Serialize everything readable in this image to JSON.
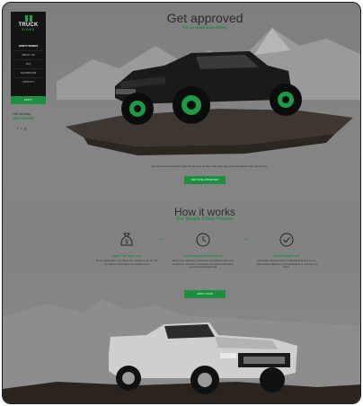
{
  "sidebar": {
    "logo_text": "TRUCK",
    "logo_sub": "SIGNS",
    "nav": [
      {
        "label": "HOW IT WORKS",
        "active": true
      },
      {
        "label": "ABOUT US",
        "active": false
      },
      {
        "label": "FAQ",
        "active": false
      },
      {
        "label": "SHOWROOM",
        "active": false
      },
      {
        "label": "CONTACT",
        "active": false
      }
    ],
    "apply_label": "APPLY",
    "call_label": "Call us today",
    "phone": "(555) 555-5555"
  },
  "hero": {
    "title": "Get approved",
    "subtitle": "for an truck loan today",
    "caption": "Get your car financed through our tier-one lenders with easy approval and hassle-free full service.",
    "cta_label": "GET PRE-APPROVED"
  },
  "how": {
    "title": "How it works",
    "subtitle": "Our Simple 3 Step Process",
    "steps": [
      {
        "icon": "money-bag-icon",
        "title": "Apply For Your Loan",
        "desc": "On the application, only takes two minutes to fill out. We only ask for information we actually need."
      },
      {
        "icon": "clock-icon",
        "title": "Check Application Progress",
        "desc": "When your application has been submitted! Check your email inbox and you should have received confirmation of your pending approval."
      },
      {
        "icon": "check-circle-icon",
        "title": "Receive Approval!",
        "desc": "Our dealer network offers creditwide financing for car loans and an afternoon your application is reviewed 24 hours."
      }
    ],
    "cta_label": "APPLY NOW"
  },
  "colors": {
    "accent": "#1d8f42",
    "sidebar_bg": "#141414",
    "background": "#828282"
  }
}
